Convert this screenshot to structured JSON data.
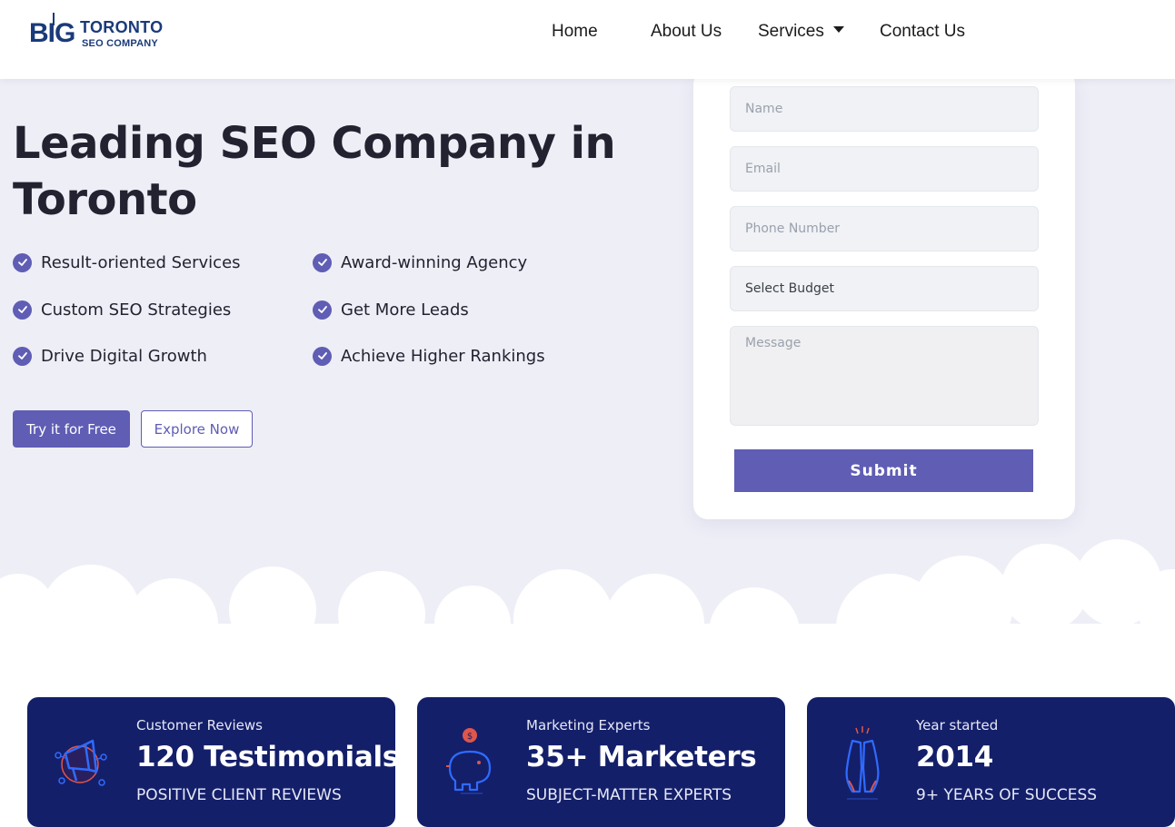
{
  "brand": {
    "logo_big": "BIG",
    "logo_top": "TORONTO",
    "logo_bottom": "SEO COMPANY",
    "colors": {
      "primary": "#5f5db4",
      "navy": "#141f6a",
      "hero_bg": "#eeeef7",
      "logo": "#1a3a7a"
    }
  },
  "nav": {
    "items": [
      {
        "label": "Home"
      },
      {
        "label": "About Us"
      },
      {
        "label": "Services"
      },
      {
        "label": "Contact Us"
      }
    ]
  },
  "hero": {
    "title": "Leading SEO Company in Toronto",
    "features": [
      {
        "label": "Result-oriented Services",
        "icon": "check-circle-icon"
      },
      {
        "label": "Award-winning Agency",
        "icon": "check-circle-icon"
      },
      {
        "label": "Custom SEO Strategies",
        "icon": "check-circle-icon"
      },
      {
        "label": "Get More Leads",
        "icon": "check-circle-icon"
      },
      {
        "label": "Drive Digital Growth",
        "icon": "check-circle-icon"
      },
      {
        "label": "Achieve Higher Rankings",
        "icon": "check-circle-icon"
      }
    ],
    "primary_button": "Try it for Free",
    "secondary_button": "Explore Now"
  },
  "form": {
    "name_placeholder": "Name",
    "email_placeholder": "Email",
    "phone_placeholder": "Phone Number",
    "budget_selected": "Select Budget",
    "message_placeholder": "Message",
    "submit_label": "Submit"
  },
  "stats": [
    {
      "label": "Customer Reviews",
      "value": "120 Testimonials",
      "sub": "POSITIVE CLIENT REVIEWS",
      "icon": "megaphone-icon"
    },
    {
      "label": "Marketing Experts",
      "value": "35+ Marketers",
      "sub": "SUBJECT-MATTER EXPERTS",
      "icon": "piggy-bank-icon"
    },
    {
      "label": "Year started",
      "value": "2014",
      "sub": "9+ YEARS OF SUCCESS",
      "icon": "high-five-icon"
    }
  ]
}
